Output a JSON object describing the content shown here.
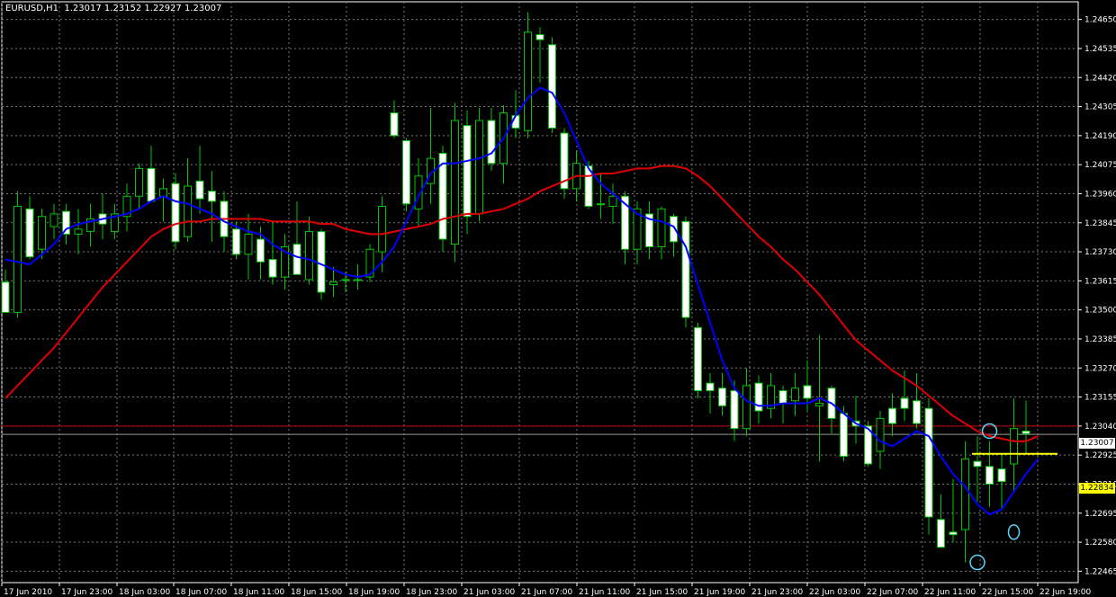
{
  "title": "EURUSD,H1  1.23017 1.23152 1.22927 1.23007",
  "last_price": "1.23007",
  "level_price": "1.22834",
  "colors": {
    "background": "#000000",
    "grid": "#7a7a7a",
    "bull_candle": "#000000",
    "bear_candle": "#ffffff",
    "wick": "#00c800",
    "ma_fast": "#0000ff",
    "ma_slow": "#e00000",
    "ask_line": "#c00000",
    "level_line": "#ffff00",
    "marker": "#58d6ff"
  },
  "chart_data": {
    "type": "candlestick",
    "symbol": "EURUSD",
    "timeframe": "H1",
    "ohlc_header": {
      "open": 1.23017,
      "high": 1.23152,
      "low": 1.22927,
      "close": 1.23007
    },
    "y_ticks": [
      "1.24650",
      "1.24535",
      "1.24420",
      "1.24305",
      "1.24190",
      "1.24075",
      "1.23960",
      "1.23845",
      "1.23730",
      "1.23615",
      "1.23500",
      "1.23385",
      "1.23270",
      "1.23155",
      "1.23040",
      "1.22925",
      "1.22810",
      "1.22695",
      "1.22580",
      "1.22465"
    ],
    "x_ticks": [
      "17 Jun 2010",
      "17 Jun 23:00",
      "18 Jun 03:00",
      "18 Jun 07:00",
      "18 Jun 11:00",
      "18 Jun 15:00",
      "18 Jun 19:00",
      "18 Jun 23:00",
      "21 Jun 03:00",
      "21 Jun 07:00",
      "21 Jun 11:00",
      "21 Jun 15:00",
      "21 Jun 19:00",
      "21 Jun 23:00",
      "22 Jun 03:00",
      "22 Jun 07:00",
      "22 Jun 11:00",
      "22 Jun 15:00",
      "22 Jun 19:00"
    ],
    "ylim": [
      1.2242,
      1.2472
    ],
    "grid": true,
    "candles": [
      {
        "o": 1.2361,
        "h": 1.2366,
        "l": 1.235,
        "c": 1.2349
      },
      {
        "o": 1.2349,
        "h": 1.2397,
        "l": 1.2347,
        "c": 1.2391
      },
      {
        "o": 1.239,
        "h": 1.2395,
        "l": 1.237,
        "c": 1.2371
      },
      {
        "o": 1.2374,
        "h": 1.239,
        "l": 1.237,
        "c": 1.2387
      },
      {
        "o": 1.2383,
        "h": 1.2392,
        "l": 1.2378,
        "c": 1.2388
      },
      {
        "o": 1.2389,
        "h": 1.2392,
        "l": 1.2376,
        "c": 1.238
      },
      {
        "o": 1.238,
        "h": 1.239,
        "l": 1.2372,
        "c": 1.2382
      },
      {
        "o": 1.2381,
        "h": 1.2392,
        "l": 1.2375,
        "c": 1.2386
      },
      {
        "o": 1.2388,
        "h": 1.2396,
        "l": 1.2378,
        "c": 1.2384
      },
      {
        "o": 1.2381,
        "h": 1.2392,
        "l": 1.2378,
        "c": 1.2388
      },
      {
        "o": 1.2387,
        "h": 1.24,
        "l": 1.2381,
        "c": 1.2395
      },
      {
        "o": 1.2395,
        "h": 1.2408,
        "l": 1.239,
        "c": 1.2406
      },
      {
        "o": 1.2406,
        "h": 1.2415,
        "l": 1.2395,
        "c": 1.2393
      },
      {
        "o": 1.2395,
        "h": 1.2402,
        "l": 1.2385,
        "c": 1.2398
      },
      {
        "o": 1.24,
        "h": 1.2404,
        "l": 1.2374,
        "c": 1.2377
      },
      {
        "o": 1.2379,
        "h": 1.241,
        "l": 1.2377,
        "c": 1.2399
      },
      {
        "o": 1.2401,
        "h": 1.2415,
        "l": 1.2388,
        "c": 1.2394
      },
      {
        "o": 1.2397,
        "h": 1.2405,
        "l": 1.2377,
        "c": 1.2393
      },
      {
        "o": 1.2393,
        "h": 1.2397,
        "l": 1.2373,
        "c": 1.2379
      },
      {
        "o": 1.2382,
        "h": 1.2385,
        "l": 1.237,
        "c": 1.2372
      },
      {
        "o": 1.2372,
        "h": 1.2388,
        "l": 1.2362,
        "c": 1.238
      },
      {
        "o": 1.2378,
        "h": 1.2383,
        "l": 1.2362,
        "c": 1.2369
      },
      {
        "o": 1.237,
        "h": 1.2385,
        "l": 1.236,
        "c": 1.2363
      },
      {
        "o": 1.2363,
        "h": 1.238,
        "l": 1.2358,
        "c": 1.2375
      },
      {
        "o": 1.2376,
        "h": 1.2393,
        "l": 1.237,
        "c": 1.2364
      },
      {
        "o": 1.2362,
        "h": 1.2387,
        "l": 1.236,
        "c": 1.2381
      },
      {
        "o": 1.2381,
        "h": 1.2382,
        "l": 1.2354,
        "c": 1.2357
      },
      {
        "o": 1.236,
        "h": 1.2367,
        "l": 1.2355,
        "c": 1.2361
      },
      {
        "o": 1.2362,
        "h": 1.2365,
        "l": 1.2357,
        "c": 1.2362
      },
      {
        "o": 1.2362,
        "h": 1.2368,
        "l": 1.2358,
        "c": 1.2362
      },
      {
        "o": 1.2363,
        "h": 1.2376,
        "l": 1.2361,
        "c": 1.2374
      },
      {
        "o": 1.2373,
        "h": 1.2395,
        "l": 1.2365,
        "c": 1.2391
      },
      {
        "o": 1.2428,
        "h": 1.2433,
        "l": 1.2418,
        "c": 1.2419
      },
      {
        "o": 1.2417,
        "h": 1.2418,
        "l": 1.2389,
        "c": 1.2392
      },
      {
        "o": 1.239,
        "h": 1.241,
        "l": 1.2383,
        "c": 1.2403
      },
      {
        "o": 1.24,
        "h": 1.243,
        "l": 1.2392,
        "c": 1.241
      },
      {
        "o": 1.2412,
        "h": 1.2415,
        "l": 1.2373,
        "c": 1.2378
      },
      {
        "o": 1.2376,
        "h": 1.2432,
        "l": 1.2369,
        "c": 1.2425
      },
      {
        "o": 1.2423,
        "h": 1.2429,
        "l": 1.238,
        "c": 1.2387
      },
      {
        "o": 1.2388,
        "h": 1.243,
        "l": 1.2385,
        "c": 1.2425
      },
      {
        "o": 1.2425,
        "h": 1.243,
        "l": 1.2405,
        "c": 1.2408
      },
      {
        "o": 1.2408,
        "h": 1.2431,
        "l": 1.24,
        "c": 1.2428
      },
      {
        "o": 1.2427,
        "h": 1.2437,
        "l": 1.2418,
        "c": 1.2422
      },
      {
        "o": 1.2421,
        "h": 1.2468,
        "l": 1.2418,
        "c": 1.246
      },
      {
        "o": 1.2459,
        "h": 1.2462,
        "l": 1.244,
        "c": 1.2457
      },
      {
        "o": 1.2455,
        "h": 1.2458,
        "l": 1.242,
        "c": 1.2422
      },
      {
        "o": 1.242,
        "h": 1.2422,
        "l": 1.2394,
        "c": 1.2398
      },
      {
        "o": 1.2398,
        "h": 1.2413,
        "l": 1.2393,
        "c": 1.2408
      },
      {
        "o": 1.2407,
        "h": 1.2409,
        "l": 1.239,
        "c": 1.2391
      },
      {
        "o": 1.2392,
        "h": 1.2404,
        "l": 1.2386,
        "c": 1.2392
      },
      {
        "o": 1.2391,
        "h": 1.24,
        "l": 1.2384,
        "c": 1.2395
      },
      {
        "o": 1.2395,
        "h": 1.2397,
        "l": 1.2368,
        "c": 1.2374
      },
      {
        "o": 1.2374,
        "h": 1.2393,
        "l": 1.2368,
        "c": 1.239
      },
      {
        "o": 1.2388,
        "h": 1.2393,
        "l": 1.237,
        "c": 1.2375
      },
      {
        "o": 1.2375,
        "h": 1.2391,
        "l": 1.237,
        "c": 1.239
      },
      {
        "o": 1.2387,
        "h": 1.2388,
        "l": 1.2371,
        "c": 1.2377
      },
      {
        "o": 1.2385,
        "h": 1.2387,
        "l": 1.2343,
        "c": 1.2347
      },
      {
        "o": 1.2343,
        "h": 1.2345,
        "l": 1.2315,
        "c": 1.2318
      },
      {
        "o": 1.2321,
        "h": 1.2325,
        "l": 1.2309,
        "c": 1.2318
      },
      {
        "o": 1.2319,
        "h": 1.2325,
        "l": 1.2308,
        "c": 1.2312
      },
      {
        "o": 1.2318,
        "h": 1.2322,
        "l": 1.2298,
        "c": 1.2303
      },
      {
        "o": 1.2303,
        "h": 1.2327,
        "l": 1.23,
        "c": 1.232
      },
      {
        "o": 1.2321,
        "h": 1.2324,
        "l": 1.2305,
        "c": 1.231
      },
      {
        "o": 1.2311,
        "h": 1.2325,
        "l": 1.2307,
        "c": 1.232
      },
      {
        "o": 1.2318,
        "h": 1.232,
        "l": 1.2305,
        "c": 1.2313
      },
      {
        "o": 1.2314,
        "h": 1.2325,
        "l": 1.2308,
        "c": 1.2319
      },
      {
        "o": 1.232,
        "h": 1.233,
        "l": 1.231,
        "c": 1.2315
      },
      {
        "o": 1.2312,
        "h": 1.234,
        "l": 1.229,
        "c": 1.2313
      },
      {
        "o": 1.2319,
        "h": 1.232,
        "l": 1.2301,
        "c": 1.2307
      },
      {
        "o": 1.2309,
        "h": 1.2312,
        "l": 1.229,
        "c": 1.2292
      },
      {
        "o": 1.2306,
        "h": 1.2316,
        "l": 1.2297,
        "c": 1.2304
      },
      {
        "o": 1.2304,
        "h": 1.2306,
        "l": 1.2288,
        "c": 1.2289
      },
      {
        "o": 1.2294,
        "h": 1.231,
        "l": 1.2287,
        "c": 1.2307
      },
      {
        "o": 1.2311,
        "h": 1.2317,
        "l": 1.23,
        "c": 1.2305
      },
      {
        "o": 1.2315,
        "h": 1.2326,
        "l": 1.2306,
        "c": 1.2311
      },
      {
        "o": 1.2314,
        "h": 1.2325,
        "l": 1.2303,
        "c": 1.2305
      },
      {
        "o": 1.2311,
        "h": 1.2315,
        "l": 1.2261,
        "c": 1.2268
      },
      {
        "o": 1.2267,
        "h": 1.2277,
        "l": 1.2259,
        "c": 1.2256
      },
      {
        "o": 1.2262,
        "h": 1.2283,
        "l": 1.2258,
        "c": 1.2261
      },
      {
        "o": 1.2263,
        "h": 1.2298,
        "l": 1.225,
        "c": 1.2291
      },
      {
        "o": 1.229,
        "h": 1.23,
        "l": 1.2274,
        "c": 1.2288
      },
      {
        "o": 1.2288,
        "h": 1.2298,
        "l": 1.2272,
        "c": 1.2281
      },
      {
        "o": 1.2287,
        "h": 1.2293,
        "l": 1.2271,
        "c": 1.2282
      },
      {
        "o": 1.2289,
        "h": 1.2315,
        "l": 1.2278,
        "c": 1.2303
      },
      {
        "o": 1.2302,
        "h": 1.2314,
        "l": 1.2293,
        "c": 1.2301
      }
    ],
    "ma_fast": [
      1.237,
      1.2369,
      1.2368,
      1.2372,
      1.2376,
      1.2382,
      1.2384,
      1.2385,
      1.2386,
      1.2387,
      1.2388,
      1.239,
      1.2393,
      1.2395,
      1.2393,
      1.2392,
      1.239,
      1.2388,
      1.2385,
      1.2383,
      1.2381,
      1.238,
      1.2376,
      1.2373,
      1.2371,
      1.237,
      1.2368,
      1.2366,
      1.2364,
      1.2363,
      1.2364,
      1.2369,
      1.2375,
      1.2385,
      1.2395,
      1.2404,
      1.2408,
      1.2408,
      1.2409,
      1.241,
      1.2412,
      1.2418,
      1.2427,
      1.2434,
      1.2438,
      1.2436,
      1.2428,
      1.2417,
      1.2406,
      1.24,
      1.2396,
      1.2392,
      1.2388,
      1.2386,
      1.2385,
      1.2383,
      1.2375,
      1.236,
      1.2345,
      1.233,
      1.2319,
      1.2314,
      1.2312,
      1.2312,
      1.2313,
      1.2313,
      1.2313,
      1.2315,
      1.2313,
      1.2309,
      1.2305,
      1.2303,
      1.2298,
      1.2296,
      1.2299,
      1.2302,
      1.23,
      1.2292,
      1.2285,
      1.228,
      1.2273,
      1.2269,
      1.2271,
      1.2278,
      1.2285,
      1.2291
    ],
    "ma_slow": [
      1.2315,
      1.232,
      1.2325,
      1.233,
      1.2335,
      1.2341,
      1.2347,
      1.2353,
      1.2359,
      1.2364,
      1.2369,
      1.2374,
      1.2379,
      1.2382,
      1.2384,
      1.2385,
      1.2385,
      1.2386,
      1.2386,
      1.2386,
      1.2386,
      1.2386,
      1.2385,
      1.2385,
      1.2385,
      1.2385,
      1.2384,
      1.2384,
      1.2382,
      1.2381,
      1.238,
      1.238,
      1.2381,
      1.2382,
      1.2383,
      1.2384,
      1.2386,
      1.2387,
      1.2388,
      1.2388,
      1.2389,
      1.239,
      1.2392,
      1.2394,
      1.2397,
      1.2399,
      1.2401,
      1.2403,
      1.2403,
      1.2404,
      1.2404,
      1.2405,
      1.2406,
      1.2406,
      1.2407,
      1.2407,
      1.2406,
      1.2403,
      1.2399,
      1.2394,
      1.2389,
      1.2384,
      1.2379,
      1.2375,
      1.237,
      1.2366,
      1.2361,
      1.2356,
      1.235,
      1.2344,
      1.2338,
      1.2334,
      1.233,
      1.2326,
      1.2323,
      1.232,
      1.2316,
      1.2312,
      1.2308,
      1.2305,
      1.2302,
      1.23,
      1.2299,
      1.2298,
      1.2298,
      1.23
    ],
    "ask_level": 1.2304,
    "bid_level": 1.23007,
    "horizontal_level": 1.22834,
    "marker_low_1": 1.225,
    "marker_low_2": 1.2262,
    "marker_high": 1.2302
  }
}
